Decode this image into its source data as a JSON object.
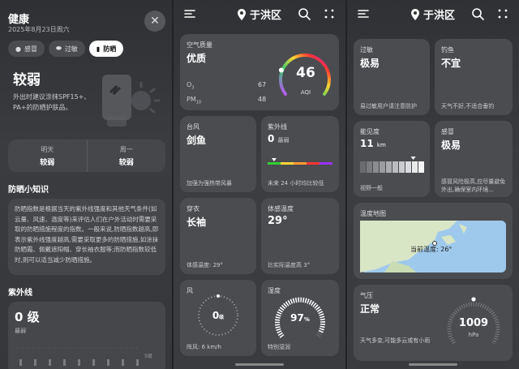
{
  "screen_health": {
    "title": "健康",
    "date": "2025年8月23日周六",
    "chips": [
      {
        "icon": "pill-icon",
        "label": "感冒"
      },
      {
        "icon": "capsule-icon",
        "label": "过敏"
      },
      {
        "icon": "sunscreen-icon",
        "label": "防晒"
      }
    ],
    "state": "较弱",
    "advice": "外出时建议涂抹SPF15+、PA+的防晒护肤品。",
    "forecast": [
      {
        "label": "明天",
        "value": "较弱"
      },
      {
        "label": "周一",
        "value": "较弱"
      }
    ],
    "knowledge_title": "防晒小知识",
    "knowledge_text": "防晒指数是根据当天的紫外线强度和其他天气条件(如云量、风速、温度等)来评估人们在户外活动时需要采取的防晒措施程度的指数。一般来说,防晒指数越高,即表示紫外线强度越高,需要采取更多的防晒措施,如涂抹防晒霜、佩戴遮阳帽、穿长袖衣服等;而防晒指数较低时,则可以适当减少防晒措施。",
    "uv_title": "紫外线",
    "uv_value": "0 级",
    "uv_level": "最弱",
    "uv_scale_max": "5级"
  },
  "header": {
    "location": "于洪区"
  },
  "screen_weather_a": {
    "aqi": {
      "label": "空气质量",
      "state": "优质",
      "value": "46",
      "unit": "AQI",
      "level": 0.22,
      "o3_label": "O",
      "o3_sub": "3",
      "o3_value": "67",
      "pm_label": "PM",
      "pm_sub": "10",
      "pm_value": "48"
    },
    "typhoon": {
      "label": "台风",
      "state": "剑鱼",
      "foot": "加强为强热带风暴"
    },
    "uv": {
      "label": "紫外线",
      "value": "0",
      "level": "最弱",
      "foot": "未来 24 小时均比较低",
      "position": 0.1
    },
    "dress": {
      "label": "穿衣",
      "state": "长袖",
      "foot": "体感温度: 29°"
    },
    "feel": {
      "label": "体感温度",
      "value": "29°",
      "foot": "比实际温度高 3°"
    },
    "wind": {
      "label": "风",
      "value": "0",
      "unit": "级",
      "foot": "阵风: 6 km/h"
    },
    "humidity": {
      "label": "湿度",
      "value": "97",
      "unit": "%",
      "foot": "特别湿润",
      "level": 0.97
    }
  },
  "screen_weather_b": {
    "cold_exercise": {
      "label": "过敏",
      "state": "极易",
      "foot": "易过敏用户请注意防护"
    },
    "fishing": {
      "label": "钓鱼",
      "state": "不宜",
      "foot": "天气不好,不适合垂钓"
    },
    "visibility": {
      "label": "能见度",
      "value": "11",
      "unit": "km",
      "foot": "视野一般",
      "position": 0.82
    },
    "cold": {
      "label": "感冒",
      "state": "极易",
      "foot": "感冒风险极高,应尽量避免外出,确保室内环境..."
    },
    "map": {
      "label": "温度地图",
      "current": "当前温度: 26°"
    },
    "pressure": {
      "label": "气压",
      "state": "正常",
      "value": "1009",
      "unit": "hPa",
      "foot": "天气多变,可能多云或有小雨",
      "level": 0.5
    }
  }
}
